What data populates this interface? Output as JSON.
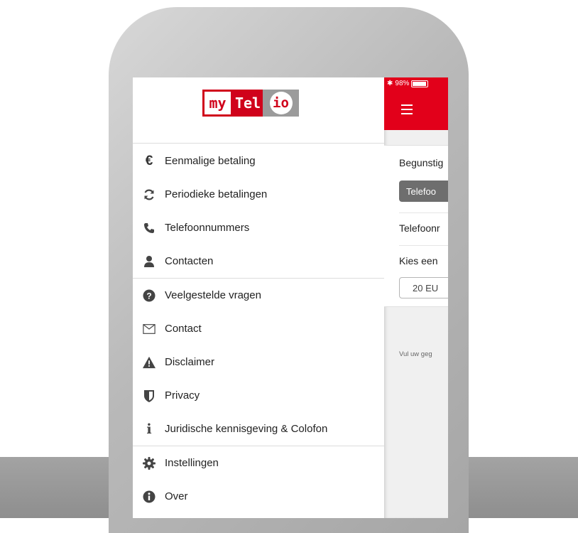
{
  "logo": {
    "part1": "my",
    "part2": "Tel",
    "part3": "io"
  },
  "menu_groups": [
    {
      "items": [
        {
          "label": "Eenmalige betaling",
          "icon": "euro-icon"
        },
        {
          "label": "Periodieke betalingen",
          "icon": "refresh-icon"
        },
        {
          "label": "Telefoonnummers",
          "icon": "phone-icon"
        },
        {
          "label": "Contacten",
          "icon": "user-icon"
        }
      ]
    },
    {
      "items": [
        {
          "label": "Veelgestelde vragen",
          "icon": "question-circle-icon"
        },
        {
          "label": "Contact",
          "icon": "envelope-icon"
        },
        {
          "label": "Disclaimer",
          "icon": "warning-icon"
        },
        {
          "label": "Privacy",
          "icon": "shield-icon"
        },
        {
          "label": "Juridische kennisgeving & Colofon",
          "icon": "info-icon"
        }
      ]
    },
    {
      "items": [
        {
          "label": "Instellingen",
          "icon": "gear-icon"
        },
        {
          "label": "Over",
          "icon": "info-circle-icon"
        }
      ]
    }
  ],
  "status_bar": {
    "bluetooth": "✱",
    "battery_text": "98%"
  },
  "main_peek": {
    "beneficiary_label": "Begunstig",
    "phone_button": "Telefoo",
    "phone_number_label": "Telefoonr",
    "choose_label": "Kies een",
    "amount_select": "20 EU",
    "footer_note": "Vul uw geg"
  },
  "colors": {
    "brand_red": "#e2001a",
    "logo_gray": "#9b9b9b",
    "button_gray": "#6e6e6e"
  }
}
